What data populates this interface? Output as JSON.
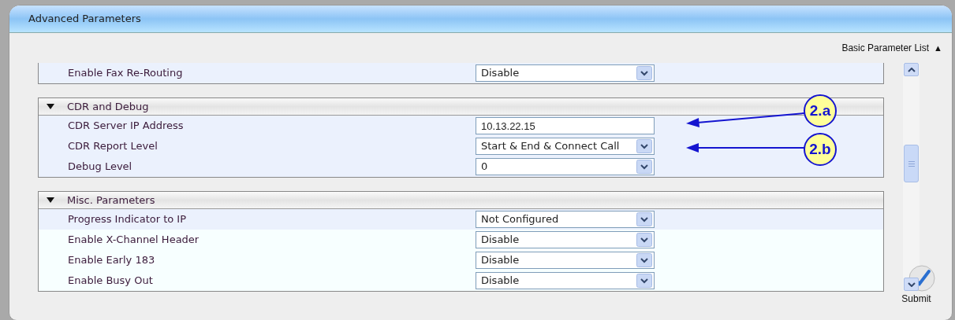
{
  "panel": {
    "title": "Advanced Parameters"
  },
  "list_toggle": {
    "label": "Basic Parameter List",
    "symbol": "▲"
  },
  "sections": [
    {
      "rows": [
        {
          "label": "Enable Fax Re-Routing",
          "kind": "select",
          "value": "Disable",
          "highlighted": true
        }
      ]
    },
    {
      "title": "CDR and Debug",
      "expanded": true,
      "rows": [
        {
          "label": "CDR Server IP Address",
          "kind": "text",
          "value": "10.13.22.15",
          "highlighted": true
        },
        {
          "label": "CDR Report Level",
          "kind": "select",
          "value": "Start & End & Connect Call",
          "highlighted": true
        },
        {
          "label": "Debug Level",
          "kind": "select",
          "value": "0",
          "highlighted": true
        }
      ]
    },
    {
      "title": "Misc. Parameters",
      "expanded": true,
      "rows": [
        {
          "label": "Progress Indicator to IP",
          "kind": "select",
          "value": "Not Configured",
          "highlighted": true
        },
        {
          "label": "Enable X-Channel Header",
          "kind": "select",
          "value": "Disable",
          "highlighted": false
        },
        {
          "label": "Enable Early 183",
          "kind": "select",
          "value": "Disable",
          "highlighted": false
        },
        {
          "label": "Enable Busy Out",
          "kind": "select",
          "value": "Disable",
          "highlighted": false
        }
      ]
    }
  ],
  "submit": {
    "label": "Submit"
  },
  "callouts": [
    {
      "label": "2.a"
    },
    {
      "label": "2.b"
    }
  ]
}
